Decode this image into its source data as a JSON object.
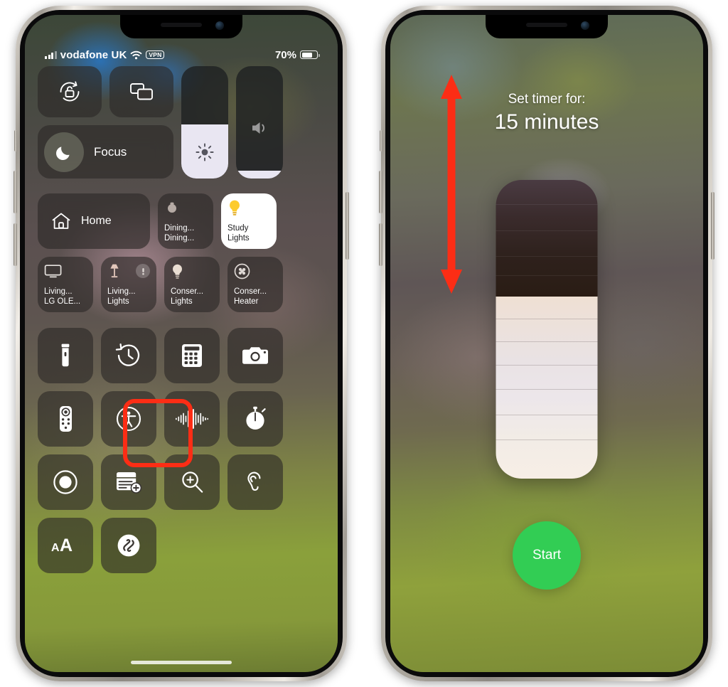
{
  "left_phone": {
    "status_bar": {
      "carrier": "vodafone UK",
      "vpn_badge": "VPN",
      "battery_percent": "70%",
      "battery_level": 70,
      "signal_bars": 3,
      "wifi_icon": "wifi-icon"
    },
    "control_center": {
      "rotation_lock": {
        "icon": "rotation-lock-icon",
        "label": "Rotation Lock"
      },
      "screen_mirroring": {
        "icon": "screen-mirroring-icon",
        "label": "Screen Mirroring"
      },
      "focus": {
        "icon": "moon-icon",
        "label": "Focus"
      },
      "brightness": {
        "icon": "brightness-icon",
        "label": "Brightness",
        "value": 48
      },
      "volume": {
        "icon": "volume-icon",
        "label": "Volume",
        "value": 7
      },
      "home_tile": {
        "icon": "home-icon",
        "label": "Home"
      },
      "home_accessories": [
        {
          "icon": "lamp-shade-icon",
          "line1": "Dining...",
          "line2": "Dining...",
          "on": false,
          "badge": false
        },
        {
          "icon": "bulb-icon",
          "line1": "Study",
          "line2": "Lights",
          "on": true,
          "badge": false
        },
        {
          "icon": "tv-icon",
          "line1": "Living...",
          "line2": "LG OLE...",
          "on": false,
          "badge": false
        },
        {
          "icon": "floor-lamp-icon",
          "line1": "Living...",
          "line2": "Lights",
          "on": false,
          "badge": true
        },
        {
          "icon": "bulb-icon",
          "line1": "Conser...",
          "line2": "Lights",
          "on": false,
          "badge": false
        },
        {
          "icon": "fan-icon",
          "line1": "Conser...",
          "line2": "Heater",
          "on": false,
          "badge": false
        }
      ],
      "app_tiles": [
        {
          "icon": "flashlight-icon",
          "label": "Flashlight",
          "highlighted": false
        },
        {
          "icon": "timer-icon",
          "label": "Timer",
          "highlighted": true
        },
        {
          "icon": "calculator-icon",
          "label": "Calculator",
          "highlighted": false
        },
        {
          "icon": "camera-icon",
          "label": "Camera",
          "highlighted": false
        },
        {
          "icon": "remote-icon",
          "label": "Apple TV Remote",
          "highlighted": false
        },
        {
          "icon": "accessibility-icon",
          "label": "Accessibility Shortcuts",
          "highlighted": false
        },
        {
          "icon": "sound-waveform-icon",
          "label": "Sound Recognition",
          "highlighted": false
        },
        {
          "icon": "stopwatch-icon",
          "label": "Stopwatch",
          "highlighted": false
        },
        {
          "icon": "screen-record-icon",
          "label": "Screen Recording",
          "highlighted": false
        },
        {
          "icon": "quick-note-icon",
          "label": "Quick Note",
          "highlighted": false
        },
        {
          "icon": "magnifier-icon",
          "label": "Magnifier",
          "highlighted": false
        },
        {
          "icon": "hearing-icon",
          "label": "Hearing",
          "highlighted": false
        },
        {
          "icon": "text-size-icon",
          "label": "aA",
          "highlighted": false
        },
        {
          "icon": "shazam-icon",
          "label": "Music Recognition",
          "highlighted": false
        }
      ],
      "highlight_color": "#fc2d15"
    }
  },
  "right_phone": {
    "timer": {
      "caption": "Set timer for:",
      "value_label": "15 minutes",
      "minutes": 15,
      "slider": {
        "name": "timer-duration-slider",
        "fill_percent": 61,
        "dark_percent": 39
      },
      "drag_arrow": {
        "icon": "vertical-double-arrow-icon",
        "color": "#fc2d15"
      },
      "start_button": {
        "label": "Start",
        "color": "#32cd54"
      }
    }
  }
}
